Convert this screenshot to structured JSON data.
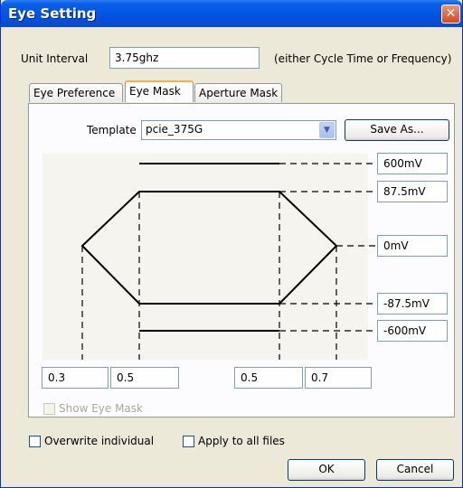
{
  "window": {
    "title": "Eye Setting",
    "close_glyph": "✕"
  },
  "unit_interval": {
    "label": "Unit Interval",
    "value": "3.75ghz",
    "hint": "(either Cycle Time or Frequency)"
  },
  "tabs": [
    {
      "label": "Eye Preference",
      "active": false
    },
    {
      "label": "Eye Mask",
      "active": true
    },
    {
      "label": "Aperture Mask",
      "active": false
    }
  ],
  "template": {
    "label": "Template",
    "selected": "pcie_375G",
    "save_as_label": "Save As..."
  },
  "voltages": [
    "600mV",
    "87.5mV",
    "0mV",
    "-87.5mV",
    "-600mV"
  ],
  "time_points": [
    "0.3",
    "0.5",
    "0.5",
    "0.7"
  ],
  "show_eye_mask": {
    "label": "Show Eye Mask",
    "checked": false,
    "disabled": true
  },
  "overwrite_individual": {
    "label": "Overwrite individual",
    "checked": false
  },
  "apply_all": {
    "label": "Apply to all files",
    "checked": false
  },
  "ok_label": "OK",
  "cancel_label": "Cancel",
  "colors": {
    "titlebar": "#0054e3",
    "dialog_bg": "#ece9d8",
    "tab_highlight": "#f4b245"
  },
  "icons": {
    "dropdown": "chevron-down-icon",
    "close": "close-icon"
  }
}
